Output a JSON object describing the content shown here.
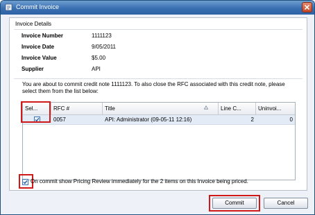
{
  "window": {
    "title": "Commit Invoice",
    "close_label": "Close"
  },
  "invoice_details": {
    "group_title": "Invoice Details",
    "fields": [
      {
        "label": "Invoice Number",
        "value": "1111123"
      },
      {
        "label": "Invoice Date",
        "value": "9/05/2011"
      },
      {
        "label": "Invoice Value",
        "value": "$5.00"
      },
      {
        "label": "Supplier",
        "value": "API"
      }
    ]
  },
  "message": "You are about to commit credit note 1111123.  To also close the RFC associated with this credit note, please select them from the list below:",
  "grid": {
    "columns": [
      "Sel...",
      "RFC #",
      "Title",
      "Line C...",
      "Uninvoi..."
    ],
    "rows": [
      {
        "selected": true,
        "rfc": "0057",
        "title": "API: Administrator (09-05-11 12:16)",
        "line_count": "2",
        "uninvoiced": "0"
      }
    ]
  },
  "pricing_review": {
    "checked": true,
    "label": "On commit show Pricing Review immediately for the 2 items on this Invoice being priced."
  },
  "buttons": {
    "commit": "Commit",
    "cancel": "Cancel"
  },
  "colors": {
    "highlight": "#d01818",
    "titlebar": "#3a6fb2"
  }
}
